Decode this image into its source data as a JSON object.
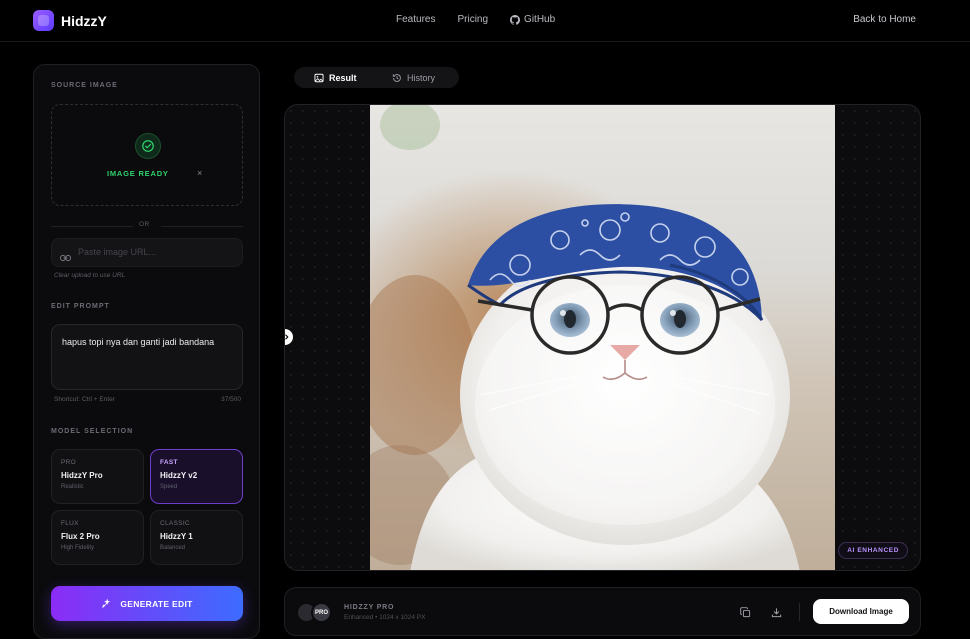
{
  "app": {
    "name": "HidzzY"
  },
  "nav": {
    "features": "Features",
    "pricing": "Pricing",
    "github": "GitHub",
    "back_home": "Back to Home"
  },
  "source": {
    "label": "SOURCE IMAGE",
    "status": "IMAGE READY",
    "remove": "×",
    "or": "OR",
    "url_placeholder": "Paste image URL...",
    "url_hint": "Clear upload to use URL"
  },
  "prompt": {
    "label": "EDIT PROMPT",
    "value": "hapus topi nya dan ganti jadi bandana",
    "shortcut": "Shortcut: Ctrl + Enter",
    "count": "37/500"
  },
  "models": {
    "label": "MODEL SELECTION",
    "selected": "HidzzY v2",
    "items": [
      {
        "tag": "PRO",
        "name": "HidzzY Pro",
        "sub": "Realistic"
      },
      {
        "tag": "FAST",
        "name": "HidzzY v2",
        "sub": "Speed"
      },
      {
        "tag": "FLUX",
        "name": "Flux 2 Pro",
        "sub": "High Fidelity"
      },
      {
        "tag": "CLASSIC",
        "name": "HidzzY 1",
        "sub": "Balanced"
      }
    ]
  },
  "generate_label": "GENERATE EDIT",
  "tabs": {
    "result": "Result",
    "history": "History",
    "active": "Result"
  },
  "preview": {
    "badge": "AI ENHANCED"
  },
  "output": {
    "avatar_label": "PRO",
    "title": "HIDZZY PRO",
    "subtitle": "Enhanced • 1024 x 1024 PX",
    "download": "Download Image"
  },
  "icons": {
    "logo": "logo-icon",
    "github": "github-icon",
    "check": "check-icon",
    "link": "link-icon",
    "sparkle": "sparkle-icon",
    "image": "image-icon",
    "history": "history-icon",
    "copy": "copy-icon",
    "download": "download-icon"
  },
  "colors": {
    "accent_purple": "#8b2cf5",
    "accent_blue": "#3d6cff",
    "ready_green": "#2fd36c",
    "badge_purple": "#b993ff"
  }
}
